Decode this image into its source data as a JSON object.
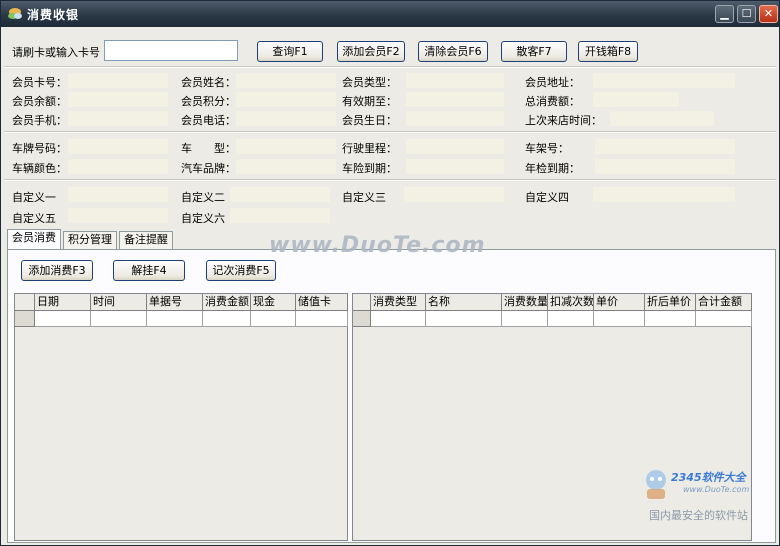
{
  "window": {
    "title": "消费收银",
    "minimize_glyph": "▁",
    "maximize_glyph": "☐",
    "close_glyph": "✕"
  },
  "toolbar": {
    "card_prompt": "请刷卡或输入卡号",
    "card_value": "",
    "query_label": "查询F1",
    "add_member_label": "添加会员F2",
    "clear_member_label": "清除会员F6",
    "walkin_label": "散客F7",
    "open_drawer_label": "开钱箱F8"
  },
  "member": {
    "card_no": "会员卡号：",
    "name": "会员姓名：",
    "type": "会员类型：",
    "address": "会员地址：",
    "balance": "会员余额：",
    "points": "会员积分：",
    "expiry": "有效期至：",
    "total_spend": "总消费额：",
    "mobile": "会员手机：",
    "phone": "会员电话：",
    "birthday": "会员生日：",
    "last_visit": "上次来店时间："
  },
  "vehicle": {
    "plate": "车牌号码：",
    "model": "车　　型：",
    "mileage": "行驶里程：",
    "frame": "车架号：",
    "color": "车辆颜色：",
    "brand": "汽车品牌：",
    "insurance_due": "车险到期：",
    "inspection_due": "年检到期："
  },
  "custom": {
    "c1": "自定义一",
    "c2": "自定义二",
    "c3": "自定义三",
    "c4": "自定义四",
    "c5": "自定义五",
    "c6": "自定义六"
  },
  "tabs": [
    "会员消费",
    "积分管理",
    "备注提醒"
  ],
  "actions": {
    "add_consumption": "添加消费F3",
    "suspend": "解挂F4",
    "count_consumption": "记次消费F5"
  },
  "left_grid": {
    "columns": [
      "日期",
      "时间",
      "单据号",
      "消费金额",
      "现金",
      "储值卡"
    ]
  },
  "right_grid": {
    "columns": [
      "消费类型",
      "名称",
      "消费数量",
      "扣减次数",
      "单价",
      "折后单价",
      "合计金额"
    ]
  },
  "watermarks": {
    "site": "www.DuoTe.com",
    "brand": "2345软件大全",
    "brand_url": "www.DuoTe.com",
    "slogan": "国内最安全的软件站"
  },
  "colors": {
    "titlebar": "#2a3745",
    "field_fill": "#f3f1e4",
    "button_border": "#1e3f7a",
    "close_button": "#c9452a"
  }
}
